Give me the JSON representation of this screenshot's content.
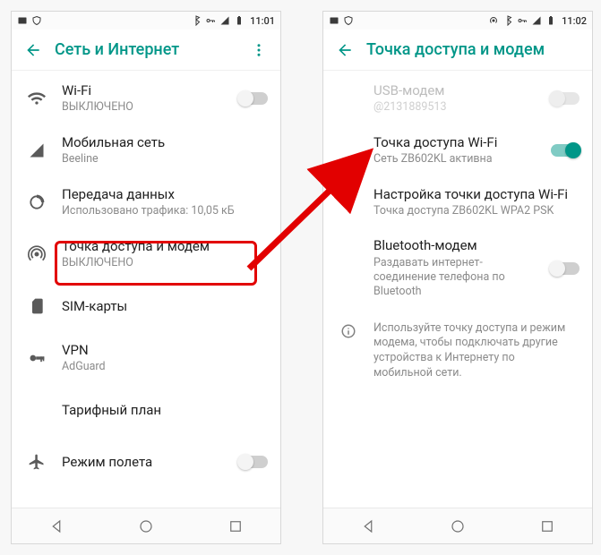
{
  "left": {
    "status": {
      "time": "11:01"
    },
    "header": {
      "title": "Сеть и Интернет"
    },
    "items": {
      "wifi": {
        "title": "Wi-Fi",
        "sub": "ВЫКЛЮЧЕНО"
      },
      "mobile": {
        "title": "Мобильная сеть",
        "sub": "Beeline"
      },
      "data": {
        "title": "Передача данных",
        "sub": "Использовано трафика: 10,05 кБ"
      },
      "tether": {
        "title": "Точка доступа и модем",
        "sub": "ВЫКЛЮЧЕНО"
      },
      "sim": {
        "title": "SIM-карты"
      },
      "vpn": {
        "title": "VPN",
        "sub": "AdGuard"
      },
      "plan": {
        "title": "Тарифный план"
      },
      "air": {
        "title": "Режим полета"
      }
    }
  },
  "right": {
    "status": {
      "time": "11:02"
    },
    "header": {
      "title": "Точка доступа и модем"
    },
    "items": {
      "usb": {
        "title": "USB-модем",
        "sub": "@2131889513"
      },
      "hotspot": {
        "title": "Точка доступа Wi-Fi",
        "sub": "Сеть ZB602KL активна"
      },
      "config": {
        "title": "Настройка точки доступа Wi-Fi",
        "sub": "Точка доступа ZB602KL WPA2 PSK"
      },
      "bt": {
        "title": "Bluetooth-модем",
        "sub": "Раздавать интернет-соединение телефона по Bluetooth"
      }
    },
    "info": "Используйте точку доступа и режим модема, чтобы подключать другие устройства к Интернету по мобильной сети."
  }
}
